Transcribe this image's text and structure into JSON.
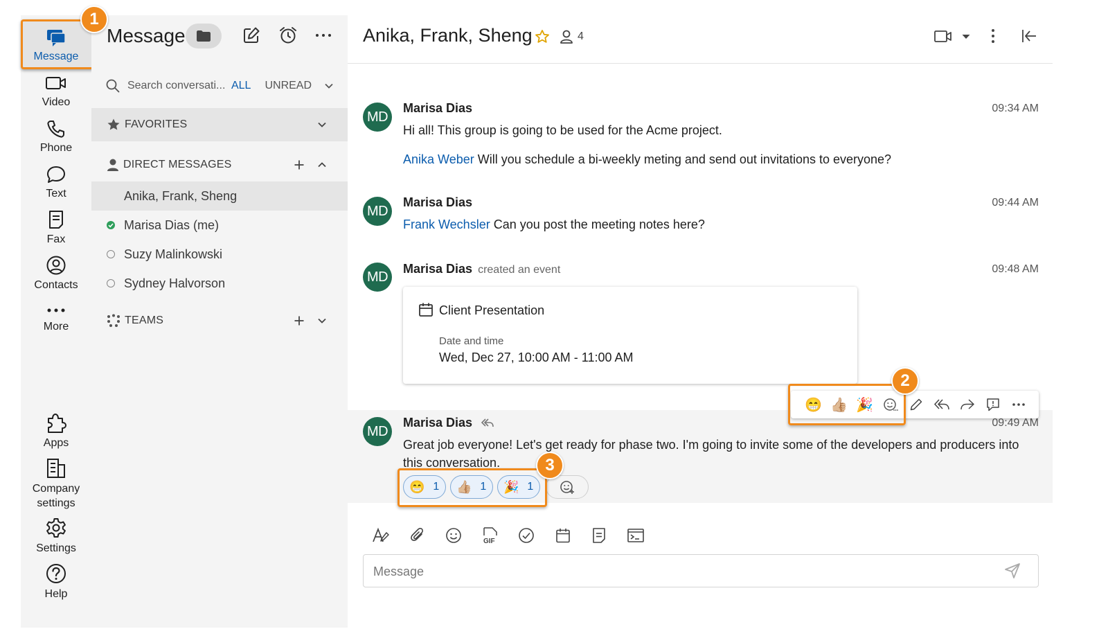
{
  "rail": {
    "items": [
      {
        "label": "Message",
        "icon": "message-icon",
        "active": true
      },
      {
        "label": "Video",
        "icon": "video-icon"
      },
      {
        "label": "Phone",
        "icon": "phone-icon"
      },
      {
        "label": "Text",
        "icon": "text-icon"
      },
      {
        "label": "Fax",
        "icon": "fax-icon"
      },
      {
        "label": "Contacts",
        "icon": "contacts-icon"
      },
      {
        "label": "More",
        "icon": "more-icon"
      },
      {
        "label": "Apps",
        "icon": "apps-icon"
      },
      {
        "label": "Company settings",
        "icon": "company-settings-icon"
      },
      {
        "label": "Settings",
        "icon": "settings-icon"
      },
      {
        "label": "Help",
        "icon": "help-icon"
      }
    ]
  },
  "convlist": {
    "title": "Message",
    "search": {
      "placeholder": "Search conversati..."
    },
    "filters": {
      "all": "ALL",
      "unread": "UNREAD"
    },
    "sections": {
      "favorites": "FAVORITES",
      "direct_messages": "DIRECT MESSAGES",
      "teams": "TEAMS"
    },
    "conversations": [
      {
        "name": "Anika, Frank, Sheng",
        "selected": true
      },
      {
        "name": "Marisa Dias (me)",
        "presence": "online"
      },
      {
        "name": "Suzy Malinkowski",
        "presence": "offline"
      },
      {
        "name": "Sydney Halvorson",
        "presence": "offline"
      }
    ]
  },
  "chat": {
    "title": "Anika, Frank, Sheng",
    "member_count": "4",
    "messages": [
      {
        "initials": "MD",
        "sender": "Marisa Dias",
        "time": "09:34 AM",
        "text": "Hi all! This group is going to be used for the Acme project.",
        "mention": "Anika Weber",
        "text2": " Will you schedule a bi-weekly meting and send out invitations to everyone?"
      },
      {
        "initials": "MD",
        "sender": "Marisa Dias",
        "time": "09:44 AM",
        "mention": "Frank Wechsler",
        "text": " Can you post the meeting notes here?"
      },
      {
        "initials": "MD",
        "sender": "Marisa Dias",
        "note": "created an event",
        "time": "09:48 AM",
        "event": {
          "title": "Client Presentation",
          "dt_label": "Date and time",
          "dt_value": "Wed, Dec 27, 10:00 AM - 11:00 AM"
        }
      },
      {
        "initials": "MD",
        "sender": "Marisa Dias",
        "time": "09:49 AM",
        "text": "Great job everyone! Let's get ready for phase two. I'm going to invite some of the developers and producers into this conversation.",
        "reactions": [
          {
            "emoji": "😁",
            "count": "1"
          },
          {
            "emoji": "👍🏼",
            "count": "1"
          },
          {
            "emoji": "🎉",
            "count": "1"
          }
        ]
      }
    ],
    "hover_toolbar": {
      "quick_reactions": [
        "😁",
        "👍🏼",
        "🎉"
      ]
    }
  },
  "composer": {
    "placeholder": "Message"
  },
  "callouts": [
    "1",
    "2",
    "3"
  ],
  "colors": {
    "accent": "#0b5cad",
    "callout": "#f08a1c",
    "avatar": "#1f6b4f",
    "online": "#2e9e5b"
  }
}
